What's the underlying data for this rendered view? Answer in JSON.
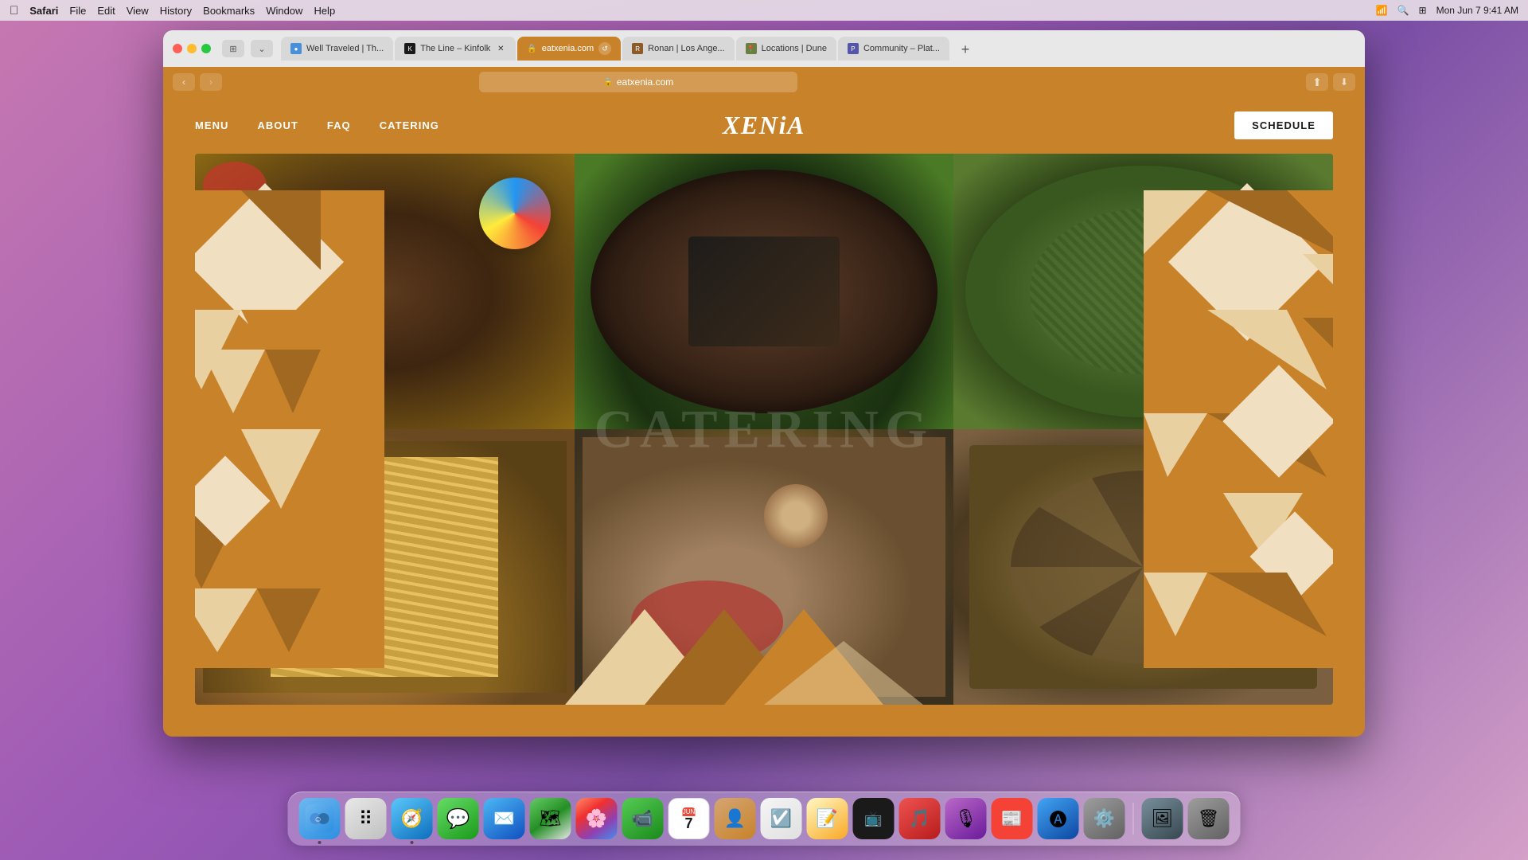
{
  "os": {
    "menubar": {
      "apple": "⌘",
      "appName": "Safari",
      "menus": [
        "File",
        "Edit",
        "View",
        "History",
        "Bookmarks",
        "Window",
        "Help"
      ],
      "clock": "Mon Jun 7  9:41 AM"
    }
  },
  "browser": {
    "tabs": [
      {
        "id": "tab1",
        "favicon": "●",
        "title": "Well Traveled | Th...",
        "active": false,
        "closeable": false
      },
      {
        "id": "tab2",
        "favicon": "K",
        "title": "The Line – Kinfolk",
        "active": false,
        "closeable": false
      },
      {
        "id": "tab3",
        "favicon": "🔒",
        "title": "eatxenia.com",
        "active": true,
        "closeable": true
      },
      {
        "id": "tab4",
        "favicon": "R",
        "title": "Ronan | Los Ange...",
        "active": false,
        "closeable": false
      },
      {
        "id": "tab5",
        "favicon": "📍",
        "title": "Locations | Dune",
        "active": false,
        "closeable": false
      },
      {
        "id": "tab6",
        "favicon": "P",
        "title": "Community – Plat...",
        "active": false,
        "closeable": false
      }
    ],
    "addressBar": {
      "url": "eatxenia.com",
      "secure": true,
      "lockIcon": "🔒"
    }
  },
  "website": {
    "nav": {
      "links": [
        "MENU",
        "ABOUT",
        "FAQ",
        "CATERING"
      ],
      "logo": "XENiA",
      "scheduleBtn": "SCHEDULE"
    },
    "hero": {
      "cateringText": "CateRinG"
    }
  },
  "dock": {
    "apps": [
      {
        "name": "Finder",
        "icon": "finder",
        "active": true
      },
      {
        "name": "Launchpad",
        "icon": "launchpad",
        "active": false
      },
      {
        "name": "Safari",
        "icon": "safari",
        "active": true
      },
      {
        "name": "Messages",
        "icon": "messages",
        "active": false
      },
      {
        "name": "Mail",
        "icon": "mail",
        "active": false
      },
      {
        "name": "Maps",
        "icon": "maps",
        "active": false
      },
      {
        "name": "Photos",
        "icon": "photos",
        "active": false
      },
      {
        "name": "FaceTime",
        "icon": "facetime",
        "active": false
      },
      {
        "name": "Calendar",
        "icon": "calendar",
        "active": false,
        "date": "7"
      },
      {
        "name": "Contacts",
        "icon": "contacts",
        "active": false
      },
      {
        "name": "Reminders",
        "icon": "reminders",
        "active": false
      },
      {
        "name": "Notes",
        "icon": "notes",
        "active": false
      },
      {
        "name": "Apple TV",
        "icon": "appletv",
        "active": false
      },
      {
        "name": "Music",
        "icon": "music",
        "active": false
      },
      {
        "name": "Podcasts",
        "icon": "podcasts",
        "active": false
      },
      {
        "name": "News",
        "icon": "news",
        "active": false
      },
      {
        "name": "App Store",
        "icon": "appstore",
        "active": false
      },
      {
        "name": "System Preferences",
        "icon": "settings",
        "active": false
      },
      {
        "name": "Preview",
        "icon": "photos2",
        "active": false
      },
      {
        "name": "Trash",
        "icon": "trash",
        "active": false
      }
    ]
  }
}
